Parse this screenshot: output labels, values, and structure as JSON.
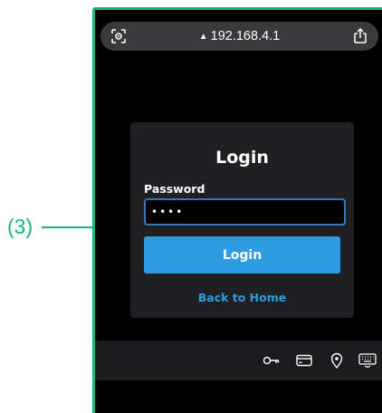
{
  "annotation": {
    "label": "(3)",
    "color": "#15b57a"
  },
  "browser": {
    "url": "192.168.4.1",
    "warning_glyph": "▲",
    "left_icon": "reader-scan-icon",
    "right_icon": "share-icon"
  },
  "login_card": {
    "title": "Login",
    "password_label": "Password",
    "password_value": "••••",
    "submit_label": "Login",
    "back_link": "Back to Home"
  },
  "bottom_bar": {
    "icons": [
      "key-icon",
      "card-icon",
      "location-pin-icon",
      "keyboard-icon"
    ]
  },
  "colors": {
    "accent": "#2f9be0",
    "input_border": "#3178b8",
    "card_bg": "#1e2022"
  }
}
